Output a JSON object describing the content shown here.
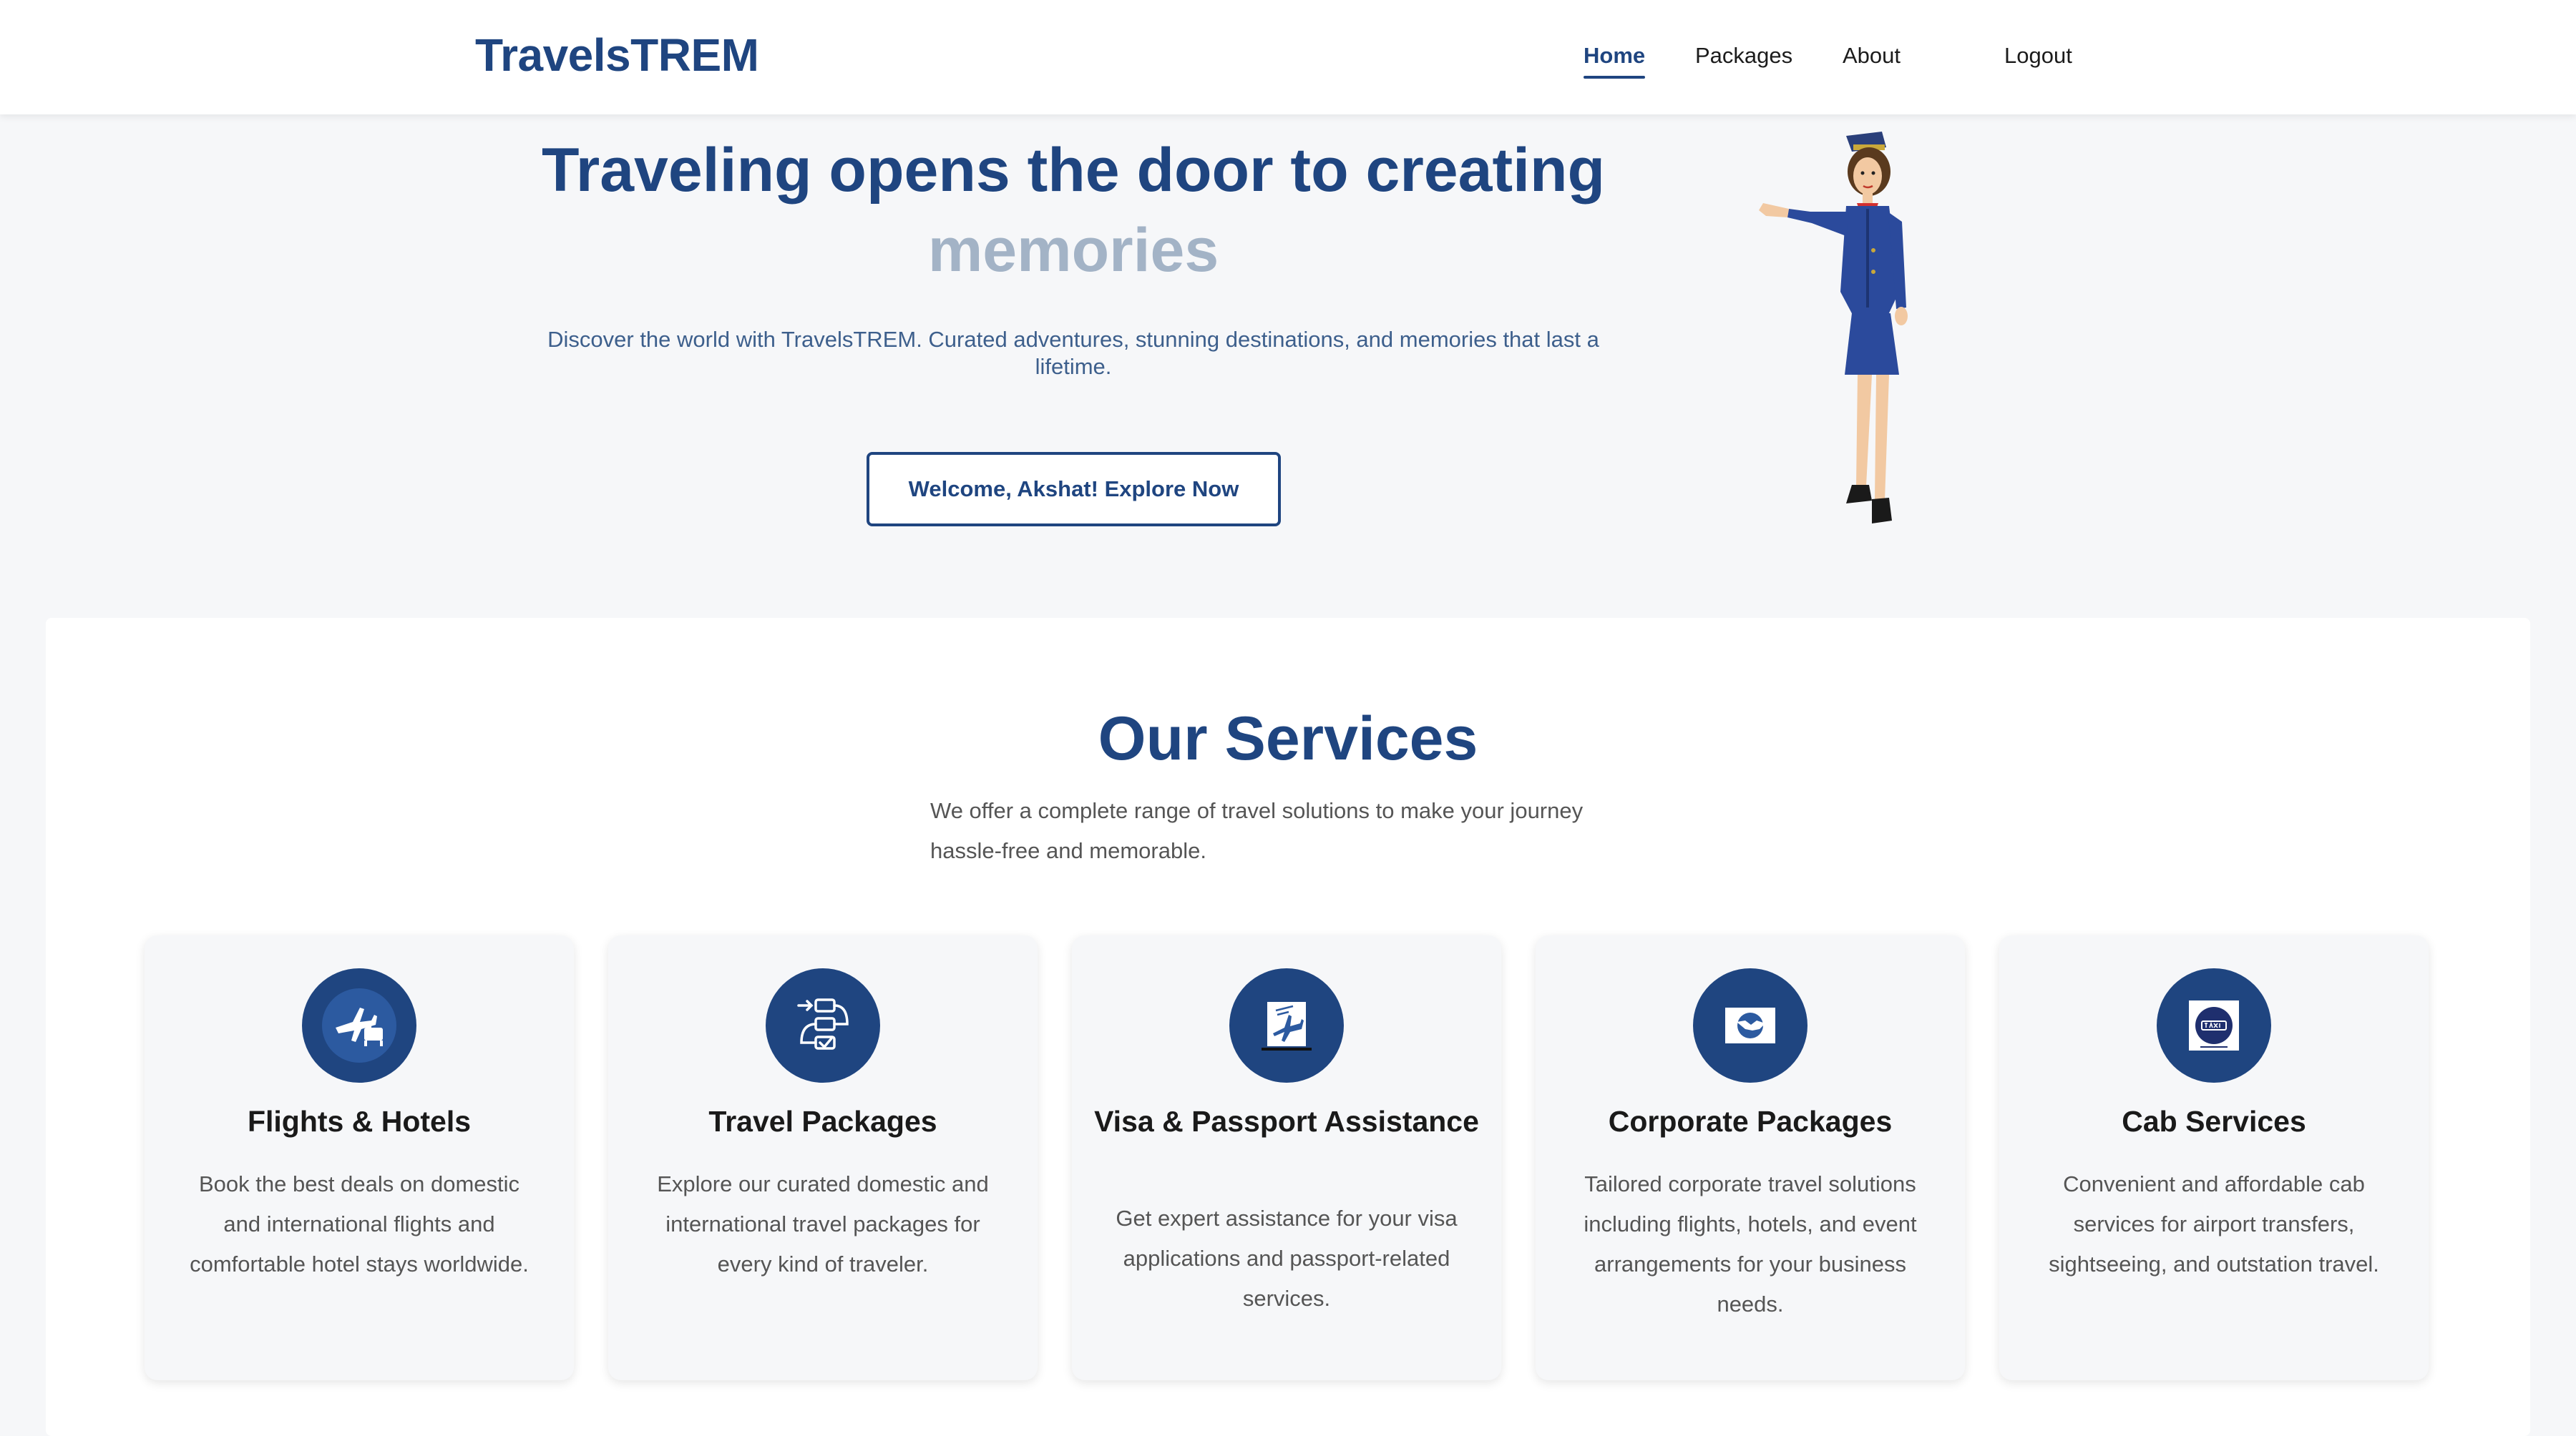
{
  "header": {
    "brand": "TravelsTREM",
    "nav": [
      "Home",
      "Packages",
      "About",
      "Logout"
    ]
  },
  "hero": {
    "title": "Traveling opens the door to creating",
    "title_accent": "memories",
    "subtitle": "Discover the world with TravelsTREM. Curated adventures, stunning destinations, and memories that last a lifetime.",
    "cta": "Welcome, Akshat! Explore Now"
  },
  "services": {
    "title": "Our Services",
    "subtitle": "We offer a complete range of travel solutions to make your journey hassle-free and memorable.",
    "items": [
      {
        "icon": "flight-hotel-icon",
        "title": "Flights & Hotels",
        "text": "Book the best deals on domestic and international flights and comfortable hotel stays worldwide."
      },
      {
        "icon": "itinerary-icon",
        "title": "Travel Packages",
        "text": "Explore our curated domestic and international travel packages for every kind of traveler."
      },
      {
        "icon": "passport-icon",
        "title": "Visa & Passport Assistance",
        "text": "Get expert assistance for your visa applications and passport-related services."
      },
      {
        "icon": "handshake-icon",
        "title": "Corporate Packages",
        "text": "Tailored corporate travel solutions including flights, hotels, and event arrangements for your business needs."
      },
      {
        "icon": "taxi-icon",
        "title": "Cab Services",
        "text": "Convenient and affordable cab services for airport transfers, sightseeing, and outstation travel."
      }
    ]
  },
  "colors": {
    "brand": "#1f4580",
    "accent_muted": "#a3b3c6",
    "text_muted": "#555555"
  }
}
